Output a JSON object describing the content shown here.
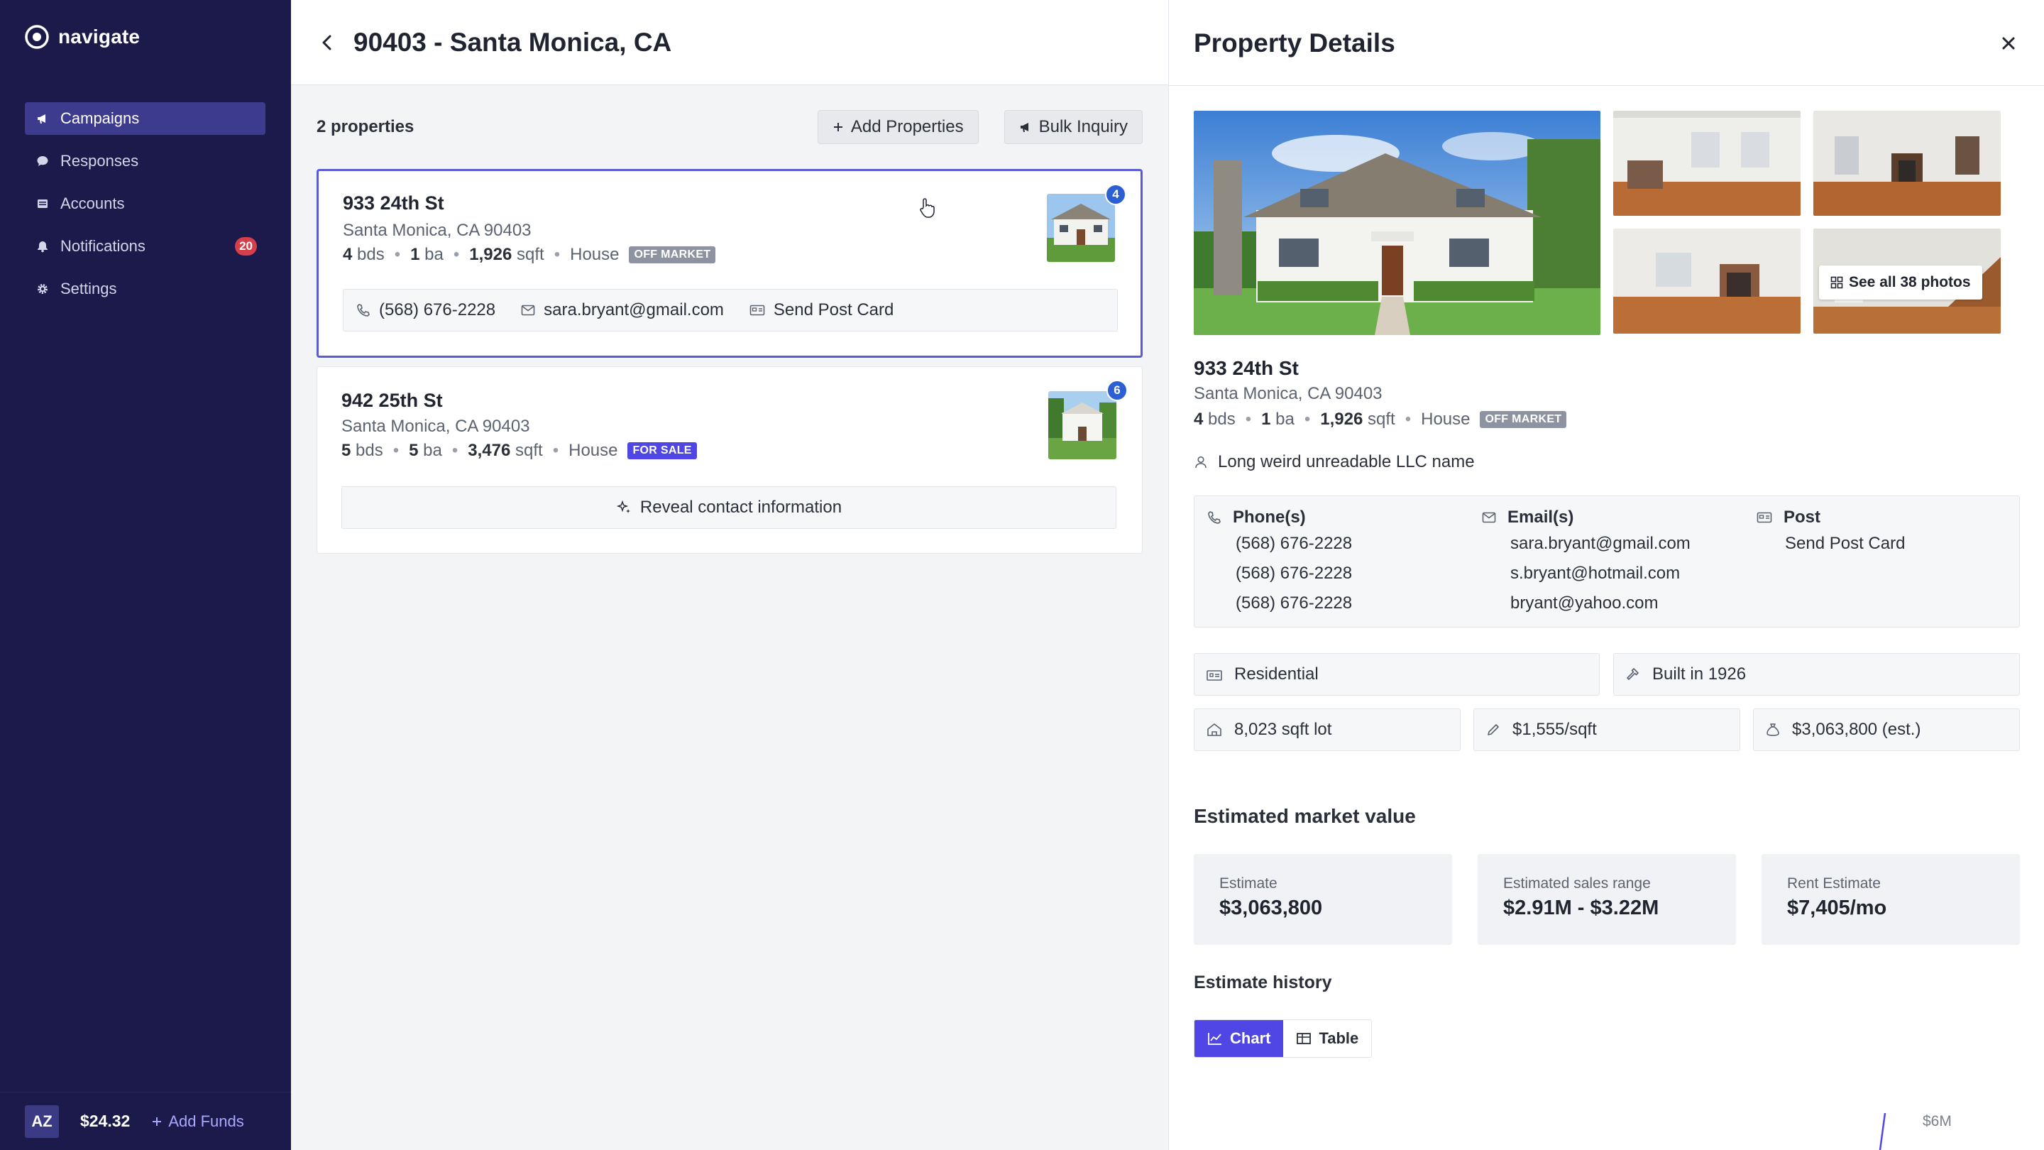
{
  "app": {
    "brand": "navigate"
  },
  "sidebar": {
    "items": [
      {
        "label": "Campaigns",
        "icon": "megaphone-icon",
        "active": true
      },
      {
        "label": "Responses",
        "icon": "chat-bubble-icon"
      },
      {
        "label": "Accounts",
        "icon": "accounts-icon"
      },
      {
        "label": "Notifications",
        "icon": "bell-icon",
        "badge": "20"
      },
      {
        "label": "Settings",
        "icon": "gear-icon"
      }
    ],
    "footer": {
      "avatar": "AZ",
      "balance": "$24.32",
      "add_funds": "Add Funds"
    }
  },
  "main": {
    "title": "90403 - Santa Monica, CA",
    "count": "2 properties",
    "add_properties": "Add Properties",
    "bulk_inquiry": "Bulk Inquiry",
    "properties": [
      {
        "address": "933 24th St",
        "city": "Santa Monica, CA 90403",
        "beds": "4",
        "beds_unit": "bds",
        "baths": "1",
        "baths_unit": "ba",
        "sqft": "1,926",
        "sqft_unit": "sqft",
        "type": "House",
        "status": "OFF MARKET",
        "photo_count": "4",
        "phone": "(568) 676-2228",
        "email": "sara.bryant@gmail.com",
        "post": "Send Post Card"
      },
      {
        "address": "942 25th St",
        "city": "Santa Monica, CA 90403",
        "beds": "5",
        "beds_unit": "bds",
        "baths": "5",
        "baths_unit": "ba",
        "sqft": "3,476",
        "sqft_unit": "sqft",
        "type": "House",
        "status": "FOR SALE",
        "photo_count": "6",
        "reveal": "Reveal contact information"
      }
    ]
  },
  "details": {
    "title": "Property Details",
    "see_all": "See all 38 photos",
    "address": "933 24th St",
    "city": "Santa Monica, CA 90403",
    "beds": "4",
    "beds_unit": "bds",
    "baths": "1",
    "baths_unit": "ba",
    "sqft": "1,926",
    "sqft_unit": "sqft",
    "type": "House",
    "status": "OFF MARKET",
    "owner": "Long weird unreadable LLC name",
    "phones_label": "Phone(s)",
    "phones": [
      "(568) 676-2228",
      "(568) 676-2228",
      "(568) 676-2228"
    ],
    "emails_label": "Email(s)",
    "emails": [
      "sara.bryant@gmail.com",
      "s.bryant@hotmail.com",
      "bryant@yahoo.com"
    ],
    "post_label": "Post",
    "post_action": "Send Post Card",
    "attributes": {
      "use": "Residential",
      "built": "Built in 1926",
      "lot": "8,023 sqft lot",
      "price_per_sqft": "$1,555/sqft",
      "value": "$3,063,800 (est.)"
    },
    "market_value_title": "Estimated market value",
    "estimates": [
      {
        "label": "Estimate",
        "value": "$3,063,800"
      },
      {
        "label": "Estimated sales range",
        "value": "$2.91M - $3.22M"
      },
      {
        "label": "Rent Estimate",
        "value": "$7,405/mo"
      }
    ],
    "history_title": "Estimate history",
    "view_chart": "Chart",
    "view_table": "Table",
    "axis_tick": "$6M"
  },
  "colors": {
    "sidebar_bg": "#1c1a4a",
    "accent": "#4f46e5",
    "badge_red": "#d63e4a",
    "photo_badge": "#2c5fd4"
  }
}
